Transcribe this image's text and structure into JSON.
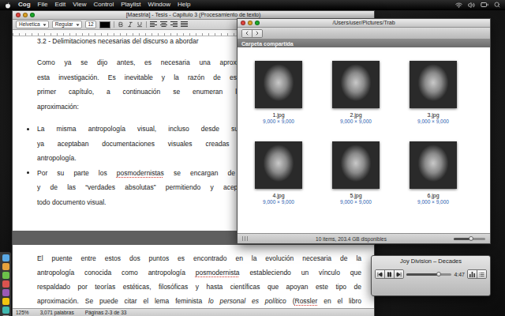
{
  "menu_bar": {
    "app": "Cog",
    "items": [
      "File",
      "Edit",
      "View",
      "Control",
      "Playlist",
      "Window",
      "Help"
    ]
  },
  "document_window": {
    "title": "[Maestria] - Tesis - Capitulo 3 (Procesamiento de texto)",
    "toolbar": {
      "font": "Helvetica",
      "style": "Regular",
      "size": "12"
    },
    "page_1": {
      "heading": "3.2 - Delimitaciones necesarias del discurso a abordar",
      "paragraph": [
        [
          {
            "text": "Como ya se dijo antes, es necesaria una aproximación intimista al discurso par",
            "kind": "plain"
          }
        ],
        [
          {
            "text": "esta investigación. Es inevitable y la razón de esto nos permite aplicar la teoría",
            "kind": "plain"
          }
        ],
        [
          {
            "text": "primer capítulo, a continuación se enumeran las razones para abordar es",
            "kind": "plain"
          }
        ],
        [
          {
            "text": "aproximación:",
            "kind": "plain"
          }
        ]
      ],
      "bullets": [
        [
          [
            {
              "text": "La misma antropología visual, incluso desde sus orígenes mas ortodoxos e",
              "kind": "plain"
            }
          ],
          [
            {
              "text": "ya aceptaban documentaciones visuales creadas por personas ajenas al c",
              "kind": "plain"
            }
          ],
          [
            {
              "text": "antropología.",
              "kind": "plain"
            }
          ]
        ],
        [
          [
            {
              "text": "Por su parte los ",
              "kind": "plain"
            },
            {
              "text": "posmodernistas",
              "kind": "misspelled"
            },
            {
              "text": " se encargan de desmentir las ideas de la “",
              "kind": "plain"
            }
          ],
          [
            {
              "text": "y de las “verdades absolutas” permitiendo y aceptando la parcialidad y la subj",
              "kind": "plain"
            }
          ],
          [
            {
              "text": "todo documento visual.",
              "kind": "plain"
            }
          ]
        ]
      ]
    },
    "page_2": {
      "lines": [
        [
          {
            "text": "El puente entre estos dos puntos es encontrado en la evolución necesaria de la",
            "kind": "plain"
          }
        ],
        [
          {
            "text": "antropología conocida como antropología ",
            "kind": "plain"
          },
          {
            "text": "posmodernista",
            "kind": "misspelled"
          },
          {
            "text": " estableciendo un vínculo que",
            "kind": "plain"
          }
        ],
        [
          {
            "text": "respaldado por teorías estéticas, filosóficas y hasta científicas que apoyan este tipo de",
            "kind": "plain"
          }
        ],
        [
          {
            "text": "aproximación. Se puede citar el lema feminista ",
            "kind": "plain"
          },
          {
            "text": "lo personal es político",
            "kind": "italic"
          },
          {
            "text": " (",
            "kind": "plain"
          },
          {
            "text": "Rossler",
            "kind": "misspelled"
          },
          {
            "text": " en el libro",
            "kind": "plain"
          }
        ]
      ]
    },
    "status_bar": {
      "zoom": "125%",
      "words": "3,071 palabras",
      "pages": "Páginas 2-3 de 33"
    }
  },
  "finder_window": {
    "title": "/Users/user/Pictures/Trab",
    "header": "Carpeta compartida",
    "files": [
      {
        "name": "1.jpg",
        "size": "9,000 × 9,000"
      },
      {
        "name": "2.jpg",
        "size": "9,000 × 9,000"
      },
      {
        "name": "3.jpg",
        "size": "9,000 × 9,000"
      },
      {
        "name": "4.jpg",
        "size": "9,000 × 9,000"
      },
      {
        "name": "5.jpg",
        "size": "9,000 × 9,000"
      },
      {
        "name": "6.jpg",
        "size": "9,000 × 9,000"
      }
    ],
    "status": "10 items, 203.4 GB disponibles",
    "icon_size_level": 0.55
  },
  "player": {
    "title": "Joy Division – Decades",
    "time": "4:47",
    "level": 0.72,
    "playing": true
  }
}
